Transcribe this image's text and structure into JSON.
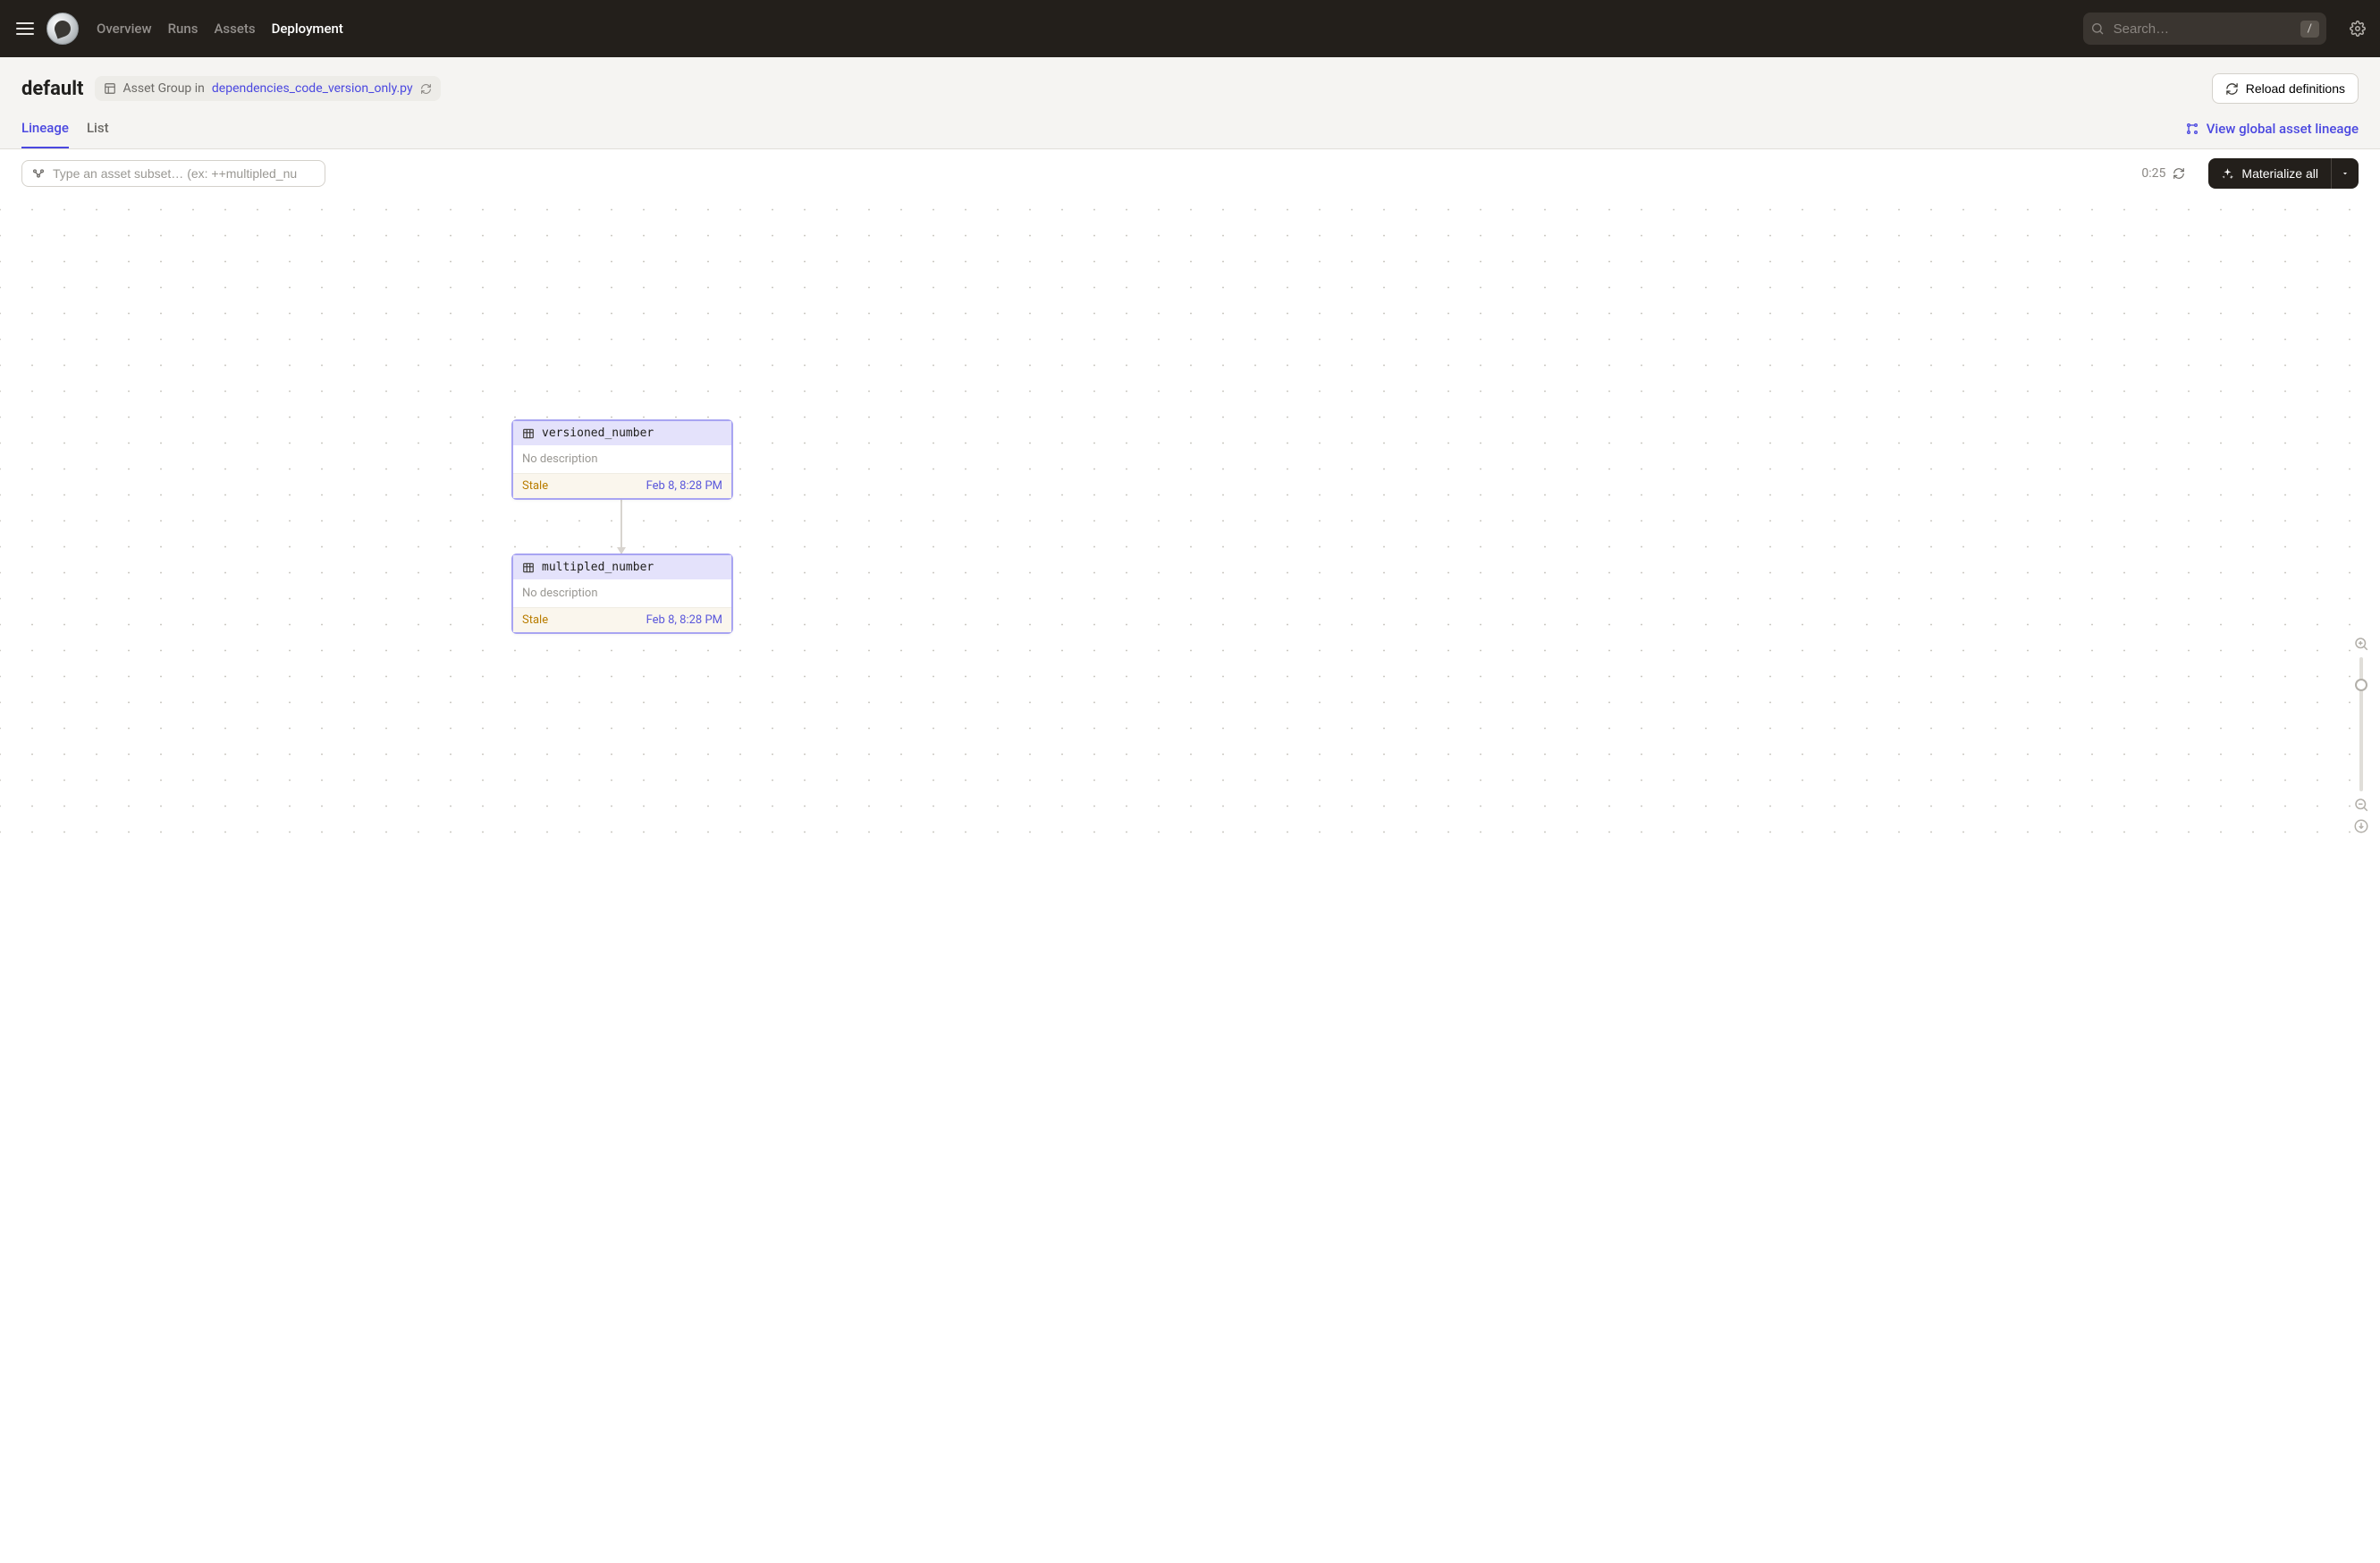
{
  "nav": {
    "overview": "Overview",
    "runs": "Runs",
    "assets": "Assets",
    "deployment": "Deployment"
  },
  "search": {
    "placeholder": "Search…",
    "shortcut": "/"
  },
  "header": {
    "title": "default",
    "chip_prefix": "Asset Group in",
    "chip_link": "dependencies_code_version_only.py",
    "reload_label": "Reload definitions"
  },
  "tabs": {
    "lineage": "Lineage",
    "list": "List"
  },
  "global_lineage": "View global asset lineage",
  "filter": {
    "placeholder": "Type an asset subset… (ex: ++multipled_nu"
  },
  "timer": "0:25",
  "materialize": "Materialize all",
  "nodes": {
    "a": {
      "name": "versioned_number",
      "desc": "No description",
      "status": "Stale",
      "ts": "Feb 8, 8:28 PM"
    },
    "b": {
      "name": "multipled_number",
      "desc": "No description",
      "status": "Stale",
      "ts": "Feb 8, 8:28 PM"
    }
  }
}
